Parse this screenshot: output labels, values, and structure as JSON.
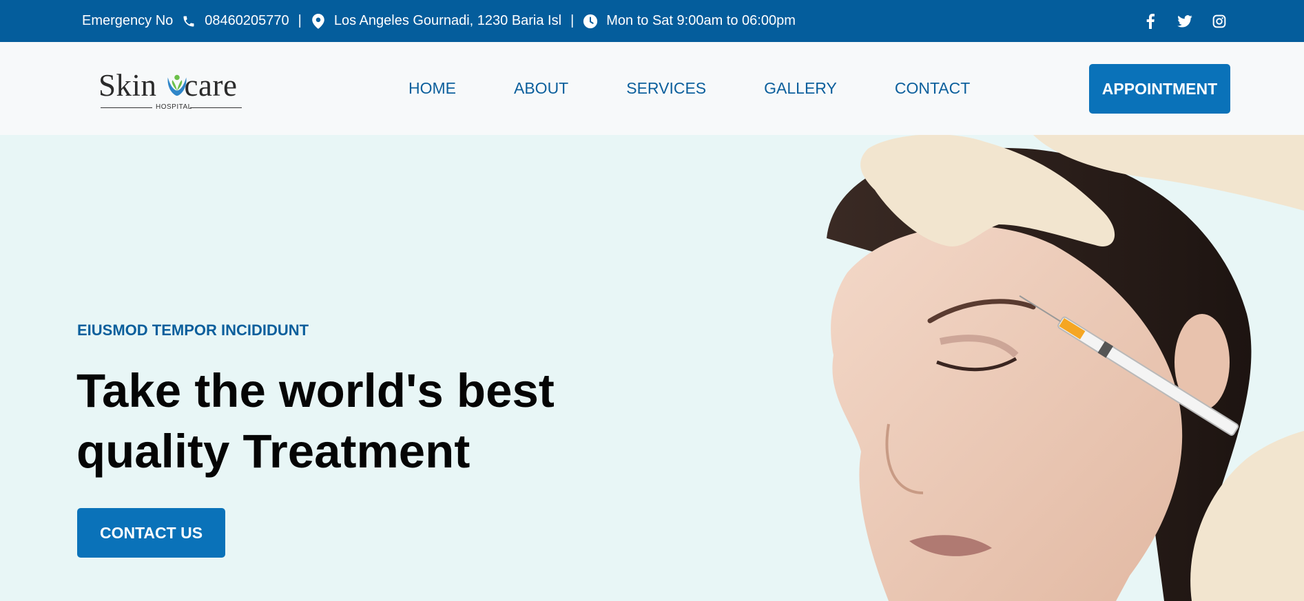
{
  "topbar": {
    "emergency_label": "Emergency No",
    "phone": "08460205770",
    "separator": "|",
    "address": "Los Angeles Gournadi, 1230 Baria Isl",
    "hours": "Mon to Sat 9:00am to 06:00pm",
    "icons": [
      "phone-icon",
      "location-pin-icon",
      "clock-icon"
    ],
    "social": [
      "facebook-icon",
      "twitter-icon",
      "instagram-icon"
    ]
  },
  "header": {
    "logo": {
      "word1": "Skin",
      "word2": "care",
      "sub": "HOSPITAL"
    },
    "nav": [
      "HOME",
      "ABOUT",
      "SERVICES",
      "GALLERY",
      "CONTACT"
    ],
    "cta": "APPOINTMENT"
  },
  "hero": {
    "eyebrow": "EIUSMOD TEMPOR INCIDIDUNT",
    "headline_line1": "Take the world's best",
    "headline_line2": "quality Treatment",
    "button": "CONTACT US"
  },
  "colors": {
    "topbar_bg": "#045d9c",
    "accent": "#0a72b9",
    "nav_text": "#0b5f9c",
    "hero_bg": "#e8f6f6"
  }
}
